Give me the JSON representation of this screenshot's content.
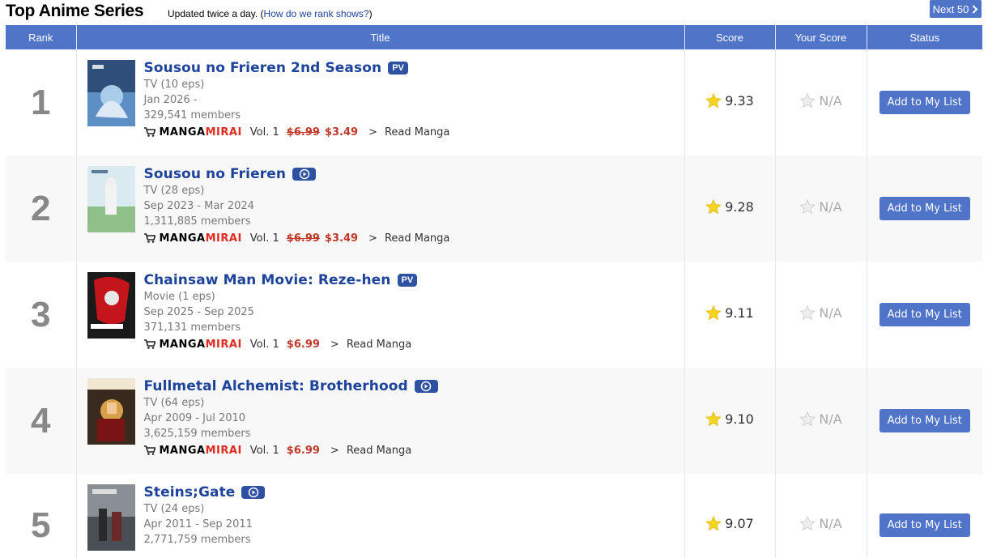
{
  "header": {
    "title": "Top Anime Series",
    "subtitle": "Updated twice a day.",
    "rank_link": "How do we rank shows?",
    "next_label": "Next 50"
  },
  "columns": {
    "rank": "Rank",
    "title": "Title",
    "score": "Score",
    "your_score": "Your Score",
    "status": "Status"
  },
  "colors": {
    "header_bg": "#4f74c8",
    "title_link": "#1d439b",
    "price_red": "#c0392b",
    "badge": "#2e51a2"
  },
  "rows": [
    {
      "rank": "1",
      "title": "Sousou no Frieren 2nd Season",
      "badge": "PV",
      "type": "TV (10 eps)",
      "dates": "Jan 2026 -",
      "members": "329,541 members",
      "manga": {
        "logo_a": "MANGA",
        "logo_b": "MIRAI",
        "vol": "Vol. 1",
        "old_price": "$6.99",
        "price": "$3.49",
        "read": "Read Manga"
      },
      "score": "9.33",
      "your_score": "N/A",
      "action": "Add to My List",
      "thumb_icon": "frieren-s2-cover"
    },
    {
      "rank": "2",
      "title": "Sousou no Frieren",
      "badge": "play-icon",
      "type": "TV (28 eps)",
      "dates": "Sep 2023 - Mar 2024",
      "members": "1,311,885 members",
      "manga": {
        "logo_a": "MANGA",
        "logo_b": "MIRAI",
        "vol": "Vol. 1",
        "old_price": "$6.99",
        "price": "$3.49",
        "read": "Read Manga"
      },
      "score": "9.28",
      "your_score": "N/A",
      "action": "Add to My List",
      "thumb_icon": "frieren-cover"
    },
    {
      "rank": "3",
      "title": "Chainsaw Man Movie: Reze-hen",
      "badge": "PV",
      "type": "Movie (1 eps)",
      "dates": "Sep 2025 - Sep 2025",
      "members": "371,131 members",
      "manga": {
        "logo_a": "MANGA",
        "logo_b": "MIRAI",
        "vol": "Vol. 1",
        "price": "$6.99",
        "read": "Read Manga"
      },
      "score": "9.11",
      "your_score": "N/A",
      "action": "Add to My List",
      "thumb_icon": "chainsaw-man-cover"
    },
    {
      "rank": "4",
      "title": "Fullmetal Alchemist: Brotherhood",
      "badge": "play-icon",
      "type": "TV (64 eps)",
      "dates": "Apr 2009 - Jul 2010",
      "members": "3,625,159 members",
      "manga": {
        "logo_a": "MANGA",
        "logo_b": "MIRAI",
        "vol": "Vol. 1",
        "price": "$6.99",
        "read": "Read Manga"
      },
      "score": "9.10",
      "your_score": "N/A",
      "action": "Add to My List",
      "thumb_icon": "fma-cover"
    },
    {
      "rank": "5",
      "title": "Steins;Gate",
      "badge": "play-icon",
      "type": "TV (24 eps)",
      "dates": "Apr 2011 - Sep 2011",
      "members": "2,771,759 members",
      "score": "9.07",
      "your_score": "N/A",
      "action": "Add to My List",
      "thumb_icon": "steins-gate-cover"
    }
  ]
}
